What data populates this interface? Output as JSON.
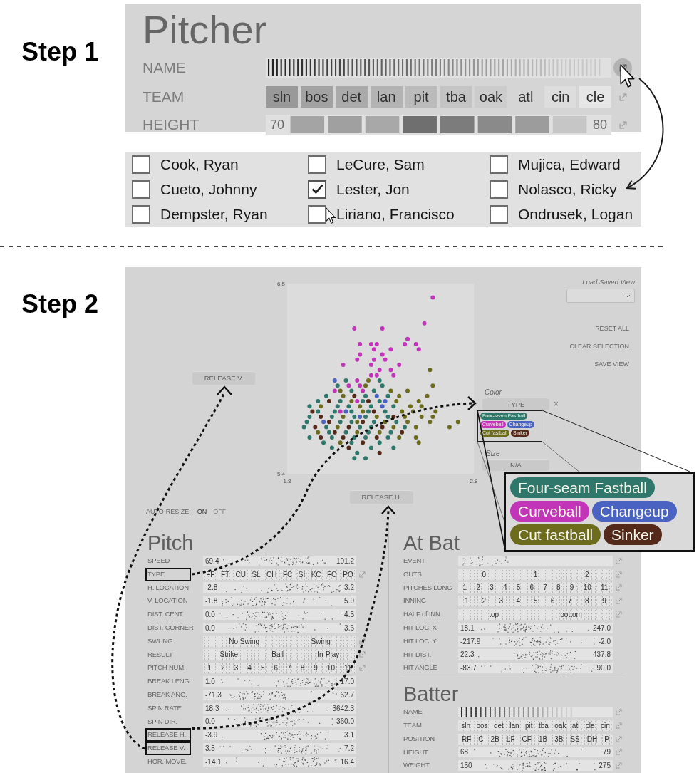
{
  "step1": {
    "label": "Step 1",
    "pitcher_panel": {
      "title": "Pitcher",
      "rows": [
        {
          "label": "NAME",
          "kind": "names",
          "expandable": true,
          "hovered": true
        },
        {
          "label": "TEAM",
          "kind": "categories",
          "values": [
            "sln",
            "bos",
            "det",
            "lan",
            "pit",
            "tba",
            "oak",
            "atl",
            "cin",
            "cle"
          ],
          "expandable": true,
          "hovered": false
        },
        {
          "label": "HEIGHT",
          "kind": "range",
          "min": "70",
          "max": "80",
          "expandable": true,
          "hovered": false
        }
      ]
    },
    "pitcher_list": {
      "items": [
        {
          "name": "Cook, Ryan",
          "checked": false
        },
        {
          "name": "Cueto, Johnny",
          "checked": false
        },
        {
          "name": "Dempster, Ryan",
          "checked": false
        },
        {
          "name": "LeCure, Sam",
          "checked": false
        },
        {
          "name": "Lester, Jon",
          "checked": true
        },
        {
          "name": "Liriano, Francisco",
          "checked": false
        },
        {
          "name": "Mujica, Edward",
          "checked": false
        },
        {
          "name": "Nolasco, Ricky",
          "checked": false
        },
        {
          "name": "Ondrusek, Logan",
          "checked": false
        }
      ]
    }
  },
  "step2": {
    "label": "Step 2",
    "plot": {
      "y_axis_button": "RELEASE V.",
      "x_axis_button": "RELEASE H.",
      "chart_data": {
        "type": "scatter",
        "xlim": [
          1.8,
          2.8
        ],
        "ylim": [
          5.4,
          6.5
        ],
        "xticks": [
          {
            "value": 1.8,
            "label": "1.8"
          },
          {
            "value": 2.8,
            "label": "2.8"
          }
        ],
        "yticks": [
          {
            "value": 5.4,
            "label": "5.4"
          },
          {
            "value": 6.5,
            "label": "6.5"
          }
        ],
        "series": [
          {
            "name": "Four-seam Fastball",
            "color": "#2f776b",
            "x": [
              2.16,
              2.22,
              2.175,
              2.04,
              2.25,
              2.37,
              1.995,
              2.145,
              2.295,
              1.92,
              2.04,
              2.16,
              2.22,
              2.34,
              2.025,
              2.115,
              2.235,
              2.355,
              1.89,
              2.01,
              2.19,
              2.25,
              2.43,
              1.905,
              2.085,
              2.145,
              2.265,
              2.385,
              1.92,
              2.04,
              2.16,
              2.22,
              2.34,
              1.965,
              2.055,
              2.145,
              2.235,
              2.325,
              1.92,
              2.07,
              2.13,
              2.25,
              2.37,
              1.965,
              2.085,
              2.205,
              2.295,
              2.01,
              2.22,
              2.34,
              2.145,
              2.265,
              2.07,
              2.31,
              2.115,
              2.295
            ],
            "values": [
              5.49,
              5.49,
              5.52,
              5.55,
              5.55,
              5.55,
              5.58,
              5.58,
              5.58,
              5.61,
              5.61,
              5.61,
              5.61,
              5.61,
              5.64,
              5.64,
              5.64,
              5.64,
              5.67,
              5.67,
              5.67,
              5.67,
              5.67,
              5.7,
              5.7,
              5.7,
              5.7,
              5.7,
              5.73,
              5.73,
              5.73,
              5.73,
              5.73,
              5.76,
              5.76,
              5.76,
              5.76,
              5.76,
              5.79,
              5.79,
              5.79,
              5.79,
              5.79,
              5.82,
              5.82,
              5.82,
              5.82,
              5.85,
              5.85,
              5.85,
              5.88,
              5.88,
              5.91,
              5.91,
              5.94,
              5.94
            ]
          },
          {
            "name": "Curveball",
            "color": "#c234b8",
            "x": [
              2.085,
              2.175,
              2.055,
              2.205,
              2.13,
              2.19,
              2.175,
              2.25,
              2.28,
              2.37,
              2.295,
              2.355,
              2.1,
              2.25,
              2.4,
              2.175,
              2.265,
              2.325,
              2.19,
              2.31,
              2.265,
              2.355,
              2.505,
              2.19,
              2.25,
              2.28,
              2.43,
              2.49,
              2.445,
              2.16,
              2.31,
              2.535,
              2.58
            ],
            "values": [
              5.76,
              5.82,
              5.88,
              5.88,
              5.91,
              5.91,
              5.94,
              5.97,
              5.97,
              5.97,
              6.0,
              6.0,
              6.03,
              6.03,
              6.03,
              6.06,
              6.06,
              6.06,
              6.09,
              6.09,
              6.12,
              6.12,
              6.12,
              6.15,
              6.15,
              6.15,
              6.15,
              6.15,
              6.18,
              6.24,
              6.24,
              6.27,
              6.42
            ]
          },
          {
            "name": "Changeup",
            "color": "#4a63c2",
            "x": [
              1.995,
              2.19,
              2.115,
              2.31,
              2.325,
              2.28,
              2.055
            ],
            "values": [
              5.7,
              5.73,
              5.76,
              5.79,
              5.82,
              5.85,
              5.94
            ]
          },
          {
            "name": "Cut fastball",
            "color": "#6d6b1c",
            "x": [
              2.085,
              2.505,
              2.4,
              2.49,
              1.965,
              2.175,
              2.295,
              2.07,
              2.37,
              2.49,
              2.67,
              2.175,
              2.325,
              2.445,
              2.565,
              2.715,
              2.1,
              2.28,
              2.43,
              2.52,
              2.58,
              2.205,
              2.415,
              2.475,
              2.595,
              1.98,
              2.19,
              2.46,
              2.52,
              2.145,
              2.385,
              2.505,
              2.1,
              2.4,
              2.55,
              2.085,
              2.355,
              2.445,
              2.22,
              2.58,
              2.235,
              2.565
            ],
            "values": [
              5.58,
              5.58,
              5.61,
              5.61,
              5.64,
              5.64,
              5.64,
              5.67,
              5.67,
              5.67,
              5.67,
              5.7,
              5.7,
              5.7,
              5.7,
              5.7,
              5.73,
              5.73,
              5.73,
              5.73,
              5.73,
              5.76,
              5.76,
              5.76,
              5.76,
              5.79,
              5.79,
              5.79,
              5.79,
              5.82,
              5.82,
              5.82,
              5.85,
              5.85,
              5.85,
              5.88,
              5.88,
              5.88,
              5.91,
              5.91,
              5.94,
              6.0
            ]
          },
          {
            "name": "Sinker",
            "color": "#55291a",
            "x": [
              2.295,
              2.13,
              2.205,
              1.98,
              2.1,
              2.28,
              2.055,
              2.415,
              1.95,
              2.13,
              2.31,
              2.025,
              2.205,
              1.98,
              2.37,
              1.935,
              2.265,
              2.025,
              2.235,
              2.16
            ],
            "values": [
              5.52,
              5.55,
              5.58,
              5.61,
              5.61,
              5.61,
              5.64,
              5.64,
              5.67,
              5.67,
              5.67,
              5.7,
              5.7,
              5.73,
              5.73,
              5.76,
              5.76,
              5.82,
              5.82,
              5.85
            ]
          }
        ]
      }
    },
    "auto_resize": {
      "label": "AUTO-RESIZE:",
      "options": [
        {
          "label": "ON",
          "selected": true
        },
        {
          "label": "OFF",
          "selected": false
        }
      ]
    },
    "saved_views": {
      "label": "Load Saved View"
    },
    "actions": [
      "RESET ALL",
      "CLEAR SELECTION",
      "SAVE VIEW"
    ],
    "color_encoding": {
      "label": "Color",
      "field": "TYPE",
      "clear": "×"
    },
    "size_encoding": {
      "label": "Size",
      "field": "N/A"
    },
    "legend_zoom": {
      "items": [
        {
          "name": "Four-seam Fastball",
          "color": "#2f776b"
        },
        {
          "name": "Curveball",
          "color": "#c234b8"
        },
        {
          "name": "Changeup",
          "color": "#4a63c2"
        },
        {
          "name": "Cut fastball",
          "color": "#6d6b1c"
        },
        {
          "name": "Sinker",
          "color": "#55291a"
        }
      ]
    },
    "pitch": {
      "title": "Pitch",
      "rows": [
        {
          "label": "SPEED",
          "kind": "range",
          "min": "69.4",
          "max": "101.2",
          "expandable": false,
          "highlighted": false
        },
        {
          "label": "TYPE",
          "kind": "categories",
          "values": [
            "FF",
            "FT",
            "CU",
            "SL",
            "CH",
            "FC",
            "SI",
            "KC",
            "FO",
            "PO"
          ],
          "expandable": true,
          "highlighted": true
        },
        {
          "label": "H. LOCATION",
          "kind": "range",
          "min": "-2.8",
          "max": "3.2",
          "expandable": false,
          "highlighted": false
        },
        {
          "label": "V. LOCATION",
          "kind": "range",
          "min": "-1.8",
          "max": "5.9",
          "expandable": false,
          "highlighted": false
        },
        {
          "label": "DIST. CENT.",
          "kind": "range",
          "min": "0.0",
          "max": "4.5",
          "expandable": false,
          "highlighted": false
        },
        {
          "label": "DIST. CORNER",
          "kind": "range",
          "min": "0.0",
          "max": "3.6",
          "expandable": false,
          "highlighted": false
        },
        {
          "label": "SWUNG",
          "kind": "categories",
          "values": [
            "No Swing",
            "Swing"
          ],
          "expandable": true,
          "highlighted": false
        },
        {
          "label": "RESULT",
          "kind": "categories",
          "values": [
            "Strike",
            "Ball",
            "In-Play"
          ],
          "expandable": true,
          "highlighted": false
        },
        {
          "label": "PITCH NUM.",
          "kind": "categories",
          "values": [
            "1",
            "2",
            "3",
            "4",
            "5",
            "6",
            "7",
            "8",
            "9",
            "10",
            "11"
          ],
          "expandable": true,
          "highlighted": false
        },
        {
          "label": "BREAK LENG.",
          "kind": "range",
          "min": "1.0",
          "max": "17.0",
          "expandable": false,
          "highlighted": false
        },
        {
          "label": "BREAK ANG.",
          "kind": "range",
          "min": "-71.3",
          "max": "62.7",
          "expandable": false,
          "highlighted": false
        },
        {
          "label": "SPIN RATE",
          "kind": "range",
          "min": "18.3",
          "max": "3642.3",
          "expandable": false,
          "highlighted": false
        },
        {
          "label": "SPIN DIR.",
          "kind": "range",
          "min": "0.0",
          "max": "360.0",
          "expandable": false,
          "highlighted": false
        },
        {
          "label": "RELEASE H.",
          "kind": "range",
          "min": "-3.9",
          "max": "3.1",
          "expandable": false,
          "highlighted": true
        },
        {
          "label": "RELEASE V.",
          "kind": "range",
          "min": "3.5",
          "max": "7.2",
          "expandable": false,
          "highlighted": true
        },
        {
          "label": "HOR. MOVE.",
          "kind": "range",
          "min": "-14.1",
          "max": "16.4",
          "expandable": false,
          "highlighted": false
        }
      ]
    },
    "at_bat": {
      "title": "At Bat",
      "rows": [
        {
          "label": "EVENT",
          "kind": "dots",
          "expandable": true
        },
        {
          "label": "OUTS",
          "kind": "categories",
          "values": [
            "0",
            "1",
            "2"
          ],
          "expandable": true
        },
        {
          "label": "PITCHES LONG",
          "kind": "categories",
          "values": [
            "1",
            "2",
            "3",
            "4",
            "5",
            "6",
            "7",
            "8",
            "9",
            "10",
            "11"
          ],
          "expandable": true
        },
        {
          "label": "INNING",
          "kind": "categories",
          "values": [
            "1",
            "2",
            "3",
            "4",
            "5",
            "6",
            "7",
            "8",
            "9"
          ],
          "expandable": true
        },
        {
          "label": "HALF of INN.",
          "kind": "categories",
          "values": [
            "top",
            "bottom"
          ],
          "expandable": true
        },
        {
          "label": "HIT LOC. X",
          "kind": "range",
          "min": "18.1",
          "max": "247.0",
          "expandable": false
        },
        {
          "label": "HIT LOC. Y",
          "kind": "range",
          "min": "-217.9",
          "max": "-2.0",
          "expandable": false
        },
        {
          "label": "HIT DIST.",
          "kind": "range",
          "min": "22.3",
          "max": "437.8",
          "expandable": false
        },
        {
          "label": "HIT ANGLE",
          "kind": "range",
          "min": "-83.7",
          "max": "90.0",
          "expandable": false
        }
      ]
    },
    "batter": {
      "title": "Batter",
      "rows": [
        {
          "label": "NAME",
          "kind": "names",
          "expandable": true
        },
        {
          "label": "TEAM",
          "kind": "categories",
          "values": [
            "sln",
            "bos",
            "det",
            "lan",
            "pit",
            "tba",
            "oak",
            "atl",
            "cle",
            "cin"
          ],
          "expandable": true
        },
        {
          "label": "POSITION",
          "kind": "categories",
          "values": [
            "RF",
            "C",
            "2B",
            "LF",
            "CF",
            "1B",
            "3B",
            "SS",
            "DH",
            "P"
          ],
          "expandable": true
        },
        {
          "label": "HEIGHT",
          "kind": "range",
          "min": "68",
          "max": "79",
          "expandable": true
        },
        {
          "label": "WEIGHT",
          "kind": "range",
          "min": "150",
          "max": "275",
          "expandable": true
        }
      ]
    }
  }
}
